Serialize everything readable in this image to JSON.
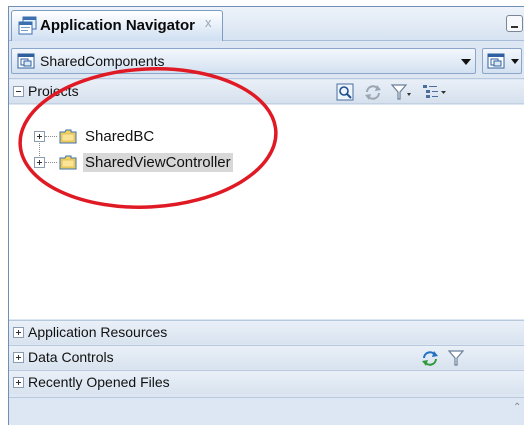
{
  "navigator": {
    "title": "Application Navigator",
    "close_glyph": "x"
  },
  "application_selector": {
    "selected": "SharedComponents"
  },
  "projects_panel": {
    "title": "Projects",
    "items": [
      {
        "label": "SharedBC",
        "selected": false
      },
      {
        "label": "SharedViewController",
        "selected": true
      }
    ]
  },
  "sections": {
    "application_resources": "Application Resources",
    "data_controls": "Data Controls",
    "recently_opened_files": "Recently Opened Files"
  },
  "icons": {
    "navigator": "application-navigator-icon",
    "app": "application-icon",
    "refresh": "refresh-icon",
    "filter": "filter-icon",
    "find": "find-icon",
    "view_options": "view-options-icon",
    "folder": "folder-icon"
  },
  "colors": {
    "annotation_ellipse": "#e01a24",
    "panel_background": "#dde7f3",
    "selection": "#d8d8d8"
  }
}
